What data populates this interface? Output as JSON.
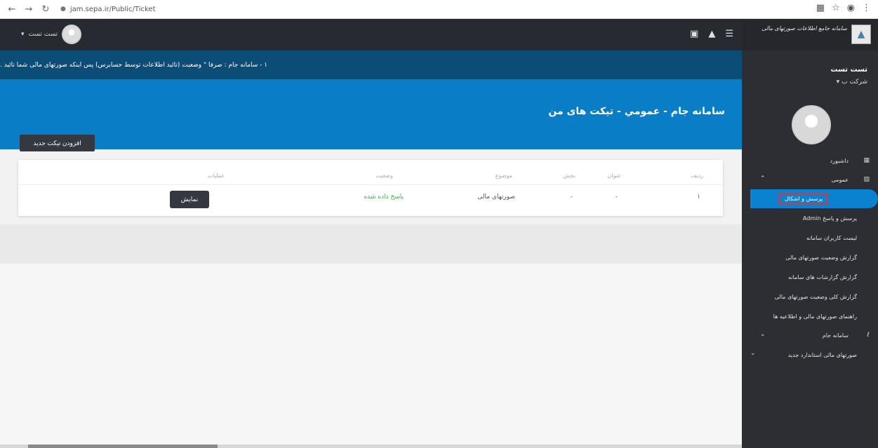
{
  "browser": {
    "url": "jam.sepa.ir/Public/Ticket"
  },
  "topbar": {
    "user_name": "تست تست"
  },
  "notice": {
    "text": "۱ - سامانه جام : صرفا \" وضعیت (تائید اطلاعات توسط حسابرس) پس اینکه صورتهای مالی شما تائید ."
  },
  "hero": {
    "title": "سامانه جام - عمومي - تيكت هاى من",
    "add_button": "افزودن تیکت جدید"
  },
  "table": {
    "headers": [
      "ردیف",
      "عنوان",
      "بخش",
      "موضوع",
      "وضعیت",
      "عملیات"
    ],
    "rows": [
      {
        "index": "۱",
        "title": "-",
        "section": "-",
        "subject": "صورتهای مالی",
        "status": "پاسخ داده شده",
        "action": "نمایش"
      }
    ]
  },
  "sidebar": {
    "logo_text": "سامانه جامع اطلاعات صورتهای مالی",
    "user_name": "تست تست",
    "company": "شرکت ب",
    "items": [
      {
        "label": "داشبورد",
        "icon": "dashboard-icon"
      },
      {
        "label": "عمومی",
        "icon": "general-icon"
      },
      {
        "label": "پرسش و اشکال",
        "active": true
      },
      {
        "label": "پرسش و پاسخ Admin"
      },
      {
        "label": "لیست کاربران سامانه"
      },
      {
        "label": "گزارش وضعیت صورتهای مالی"
      },
      {
        "label": "گزارش گزارشات های سامانه"
      },
      {
        "label": "گزارش کلی وضعیت صورتهای مالی"
      },
      {
        "label": "راهنمای صورتهای مالی و اطلاعیه ها"
      },
      {
        "label": "سامانه جام",
        "icon": "jam-icon"
      },
      {
        "label": "صورتهای مالی استاندارد جدید"
      }
    ]
  },
  "colors": {
    "topbar": "#272a31",
    "notice": "#0b4d77",
    "hero": "#0a7dc7",
    "sidebar": "#2c2e33",
    "active_item": "#0a82cf",
    "status_green": "#3ab34a",
    "highlight_red": "#e0323b"
  }
}
